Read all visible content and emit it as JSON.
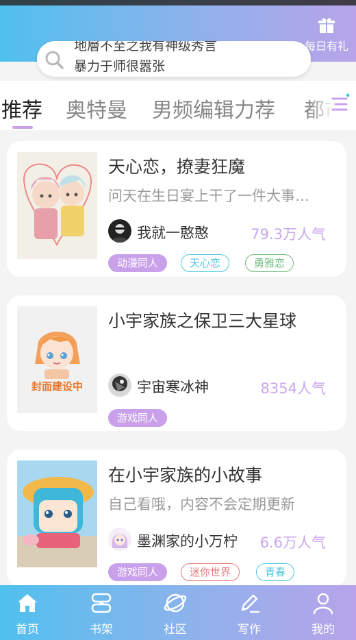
{
  "header": {
    "gift_label": "每日有礼",
    "gradient_colors": [
      "#4fc0ee",
      "#8fb2ec",
      "#b8a3ea"
    ]
  },
  "search": {
    "line1": "地層不至之我有神级秀言",
    "line2": "暴力于师很嚣张"
  },
  "tabs": [
    {
      "label": "推荐",
      "active": true
    },
    {
      "label": "奥特曼",
      "active": false
    },
    {
      "label": "男频编辑力荐",
      "active": false
    },
    {
      "label": "都市",
      "active": false
    }
  ],
  "books": [
    {
      "title": "天心恋，撩妻狂魔",
      "description": "问天在生日宴上干了一件大事…",
      "author": "我就一憨憨",
      "popularity": "79.3万人气",
      "tags": [
        {
          "label": "动漫同人",
          "style": "filled",
          "color": "#c9a0ea"
        },
        {
          "label": "天心恋",
          "style": "outline",
          "color": "#4fc6e0"
        },
        {
          "label": "勇雅恋",
          "style": "outline",
          "color": "#6dbb7a"
        }
      ]
    },
    {
      "title": "小宇家族之保卫三大星球",
      "description": "",
      "author": "宇宙寒冰神",
      "popularity": "8354人气",
      "cover_text": "封面建设中",
      "tags": [
        {
          "label": "游戏同人",
          "style": "filled",
          "color": "#c9a0ea"
        }
      ]
    },
    {
      "title": "在小宇家族的小故事",
      "description": "自己看哦，内容不会定期更新",
      "author": "墨渊家的小万柠",
      "popularity": "6.6万人气",
      "tags": [
        {
          "label": "游戏同人",
          "style": "filled",
          "color": "#c9a0ea"
        },
        {
          "label": "迷你世界",
          "style": "outline",
          "color": "#e57a7a"
        },
        {
          "label": "青春",
          "style": "outline",
          "color": "#4fc6e0"
        }
      ]
    }
  ],
  "bottom_nav": [
    {
      "label": "首页",
      "icon": "home-icon"
    },
    {
      "label": "书架",
      "icon": "bookshelf-icon"
    },
    {
      "label": "社区",
      "icon": "planet-icon"
    },
    {
      "label": "写作",
      "icon": "pen-icon"
    },
    {
      "label": "我的",
      "icon": "user-icon"
    }
  ]
}
